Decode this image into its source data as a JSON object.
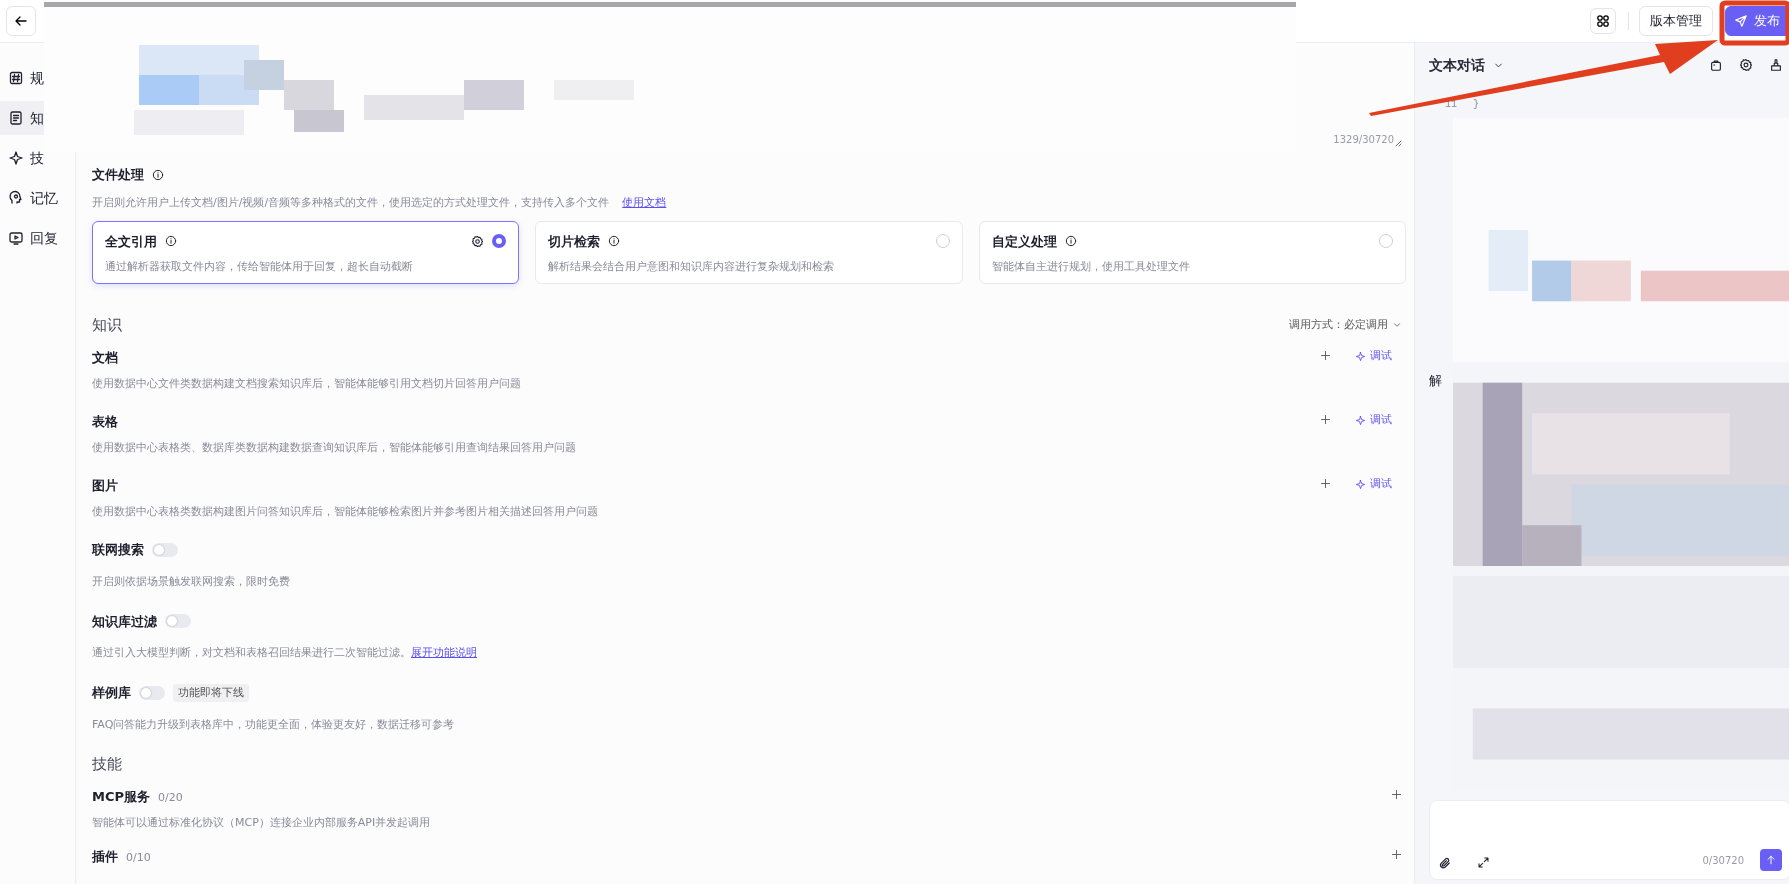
{
  "header": {
    "buttons": [
      {
        "label": "版本管理",
        "kind": "outline"
      },
      {
        "label": "发布",
        "kind": "primary"
      }
    ]
  },
  "sidebar": {
    "items": [
      {
        "label": "规",
        "selected": false
      },
      {
        "label": "知",
        "selected": true
      },
      {
        "label": "技",
        "selected": false
      },
      {
        "label": "记忆",
        "selected": false
      },
      {
        "label": "回复",
        "selected": false
      }
    ]
  },
  "prompt": {
    "counter": "1329/30720"
  },
  "file_processing": {
    "title": "文件处理",
    "description": "开启则允许用户上传文档/图片/视频/音频等多种格式的文件，使用选定的方式处理文件，支持传入多个文件",
    "link": "使用文档",
    "options": [
      {
        "title": "全文引用",
        "description": "通过解析器获取文件内容，传给智能体用于回复，超长自动截断",
        "selected": true
      },
      {
        "title": "切片检索",
        "description": "解析结果会结合用户意图和知识库内容进行复杂规划和检索",
        "selected": false
      },
      {
        "title": "自定义处理",
        "description": "智能体自主进行规划，使用工具处理文件",
        "selected": false
      }
    ]
  },
  "knowledge": {
    "title": "知识",
    "call_mode_label": "调用方式：",
    "call_mode_value": "必定调用",
    "items": [
      {
        "title": "文档",
        "description": "使用数据中心文件类数据构建文档搜索知识库后，智能体能够引用文档切片回答用户问题",
        "action": "调试"
      },
      {
        "title": "表格",
        "description": "使用数据中心表格类、数据库类数据构建数据查询知识库后，智能体能够引用查询结果回答用户问题",
        "action": "调试"
      },
      {
        "title": "图片",
        "description": "使用数据中心表格类数据构建图片问答知识库后，智能体能够检索图片并参考图片相关描述回答用户问题",
        "action": "调试"
      }
    ]
  },
  "settings": [
    {
      "title": "联网搜索",
      "on": false,
      "description": "开启则依据场景触发联网搜索，限时免费"
    },
    {
      "title": "知识库过滤",
      "on": false,
      "description": "通过引入大模型判断，对文档和表格召回结果进行二次智能过滤。",
      "link": "展开功能说明"
    },
    {
      "title": "样例库",
      "on": false,
      "tag": "功能即将下线",
      "description": "FAQ问答能力升级到表格库中，功能更全面，体验更友好，数据迁移可参考"
    }
  ],
  "skills": {
    "title": "技能",
    "items": [
      {
        "title": "MCP服务",
        "count": "0/20",
        "description": "智能体可以通过标准化协议（MCP）连接企业内部服务API并发起调用"
      },
      {
        "title": "插件",
        "count": "0/10"
      }
    ]
  },
  "chat": {
    "title": "文本对话",
    "code_line": {
      "number": "11",
      "text": "}"
    },
    "side_text": "解",
    "input": {
      "counter": "0/30720"
    }
  }
}
